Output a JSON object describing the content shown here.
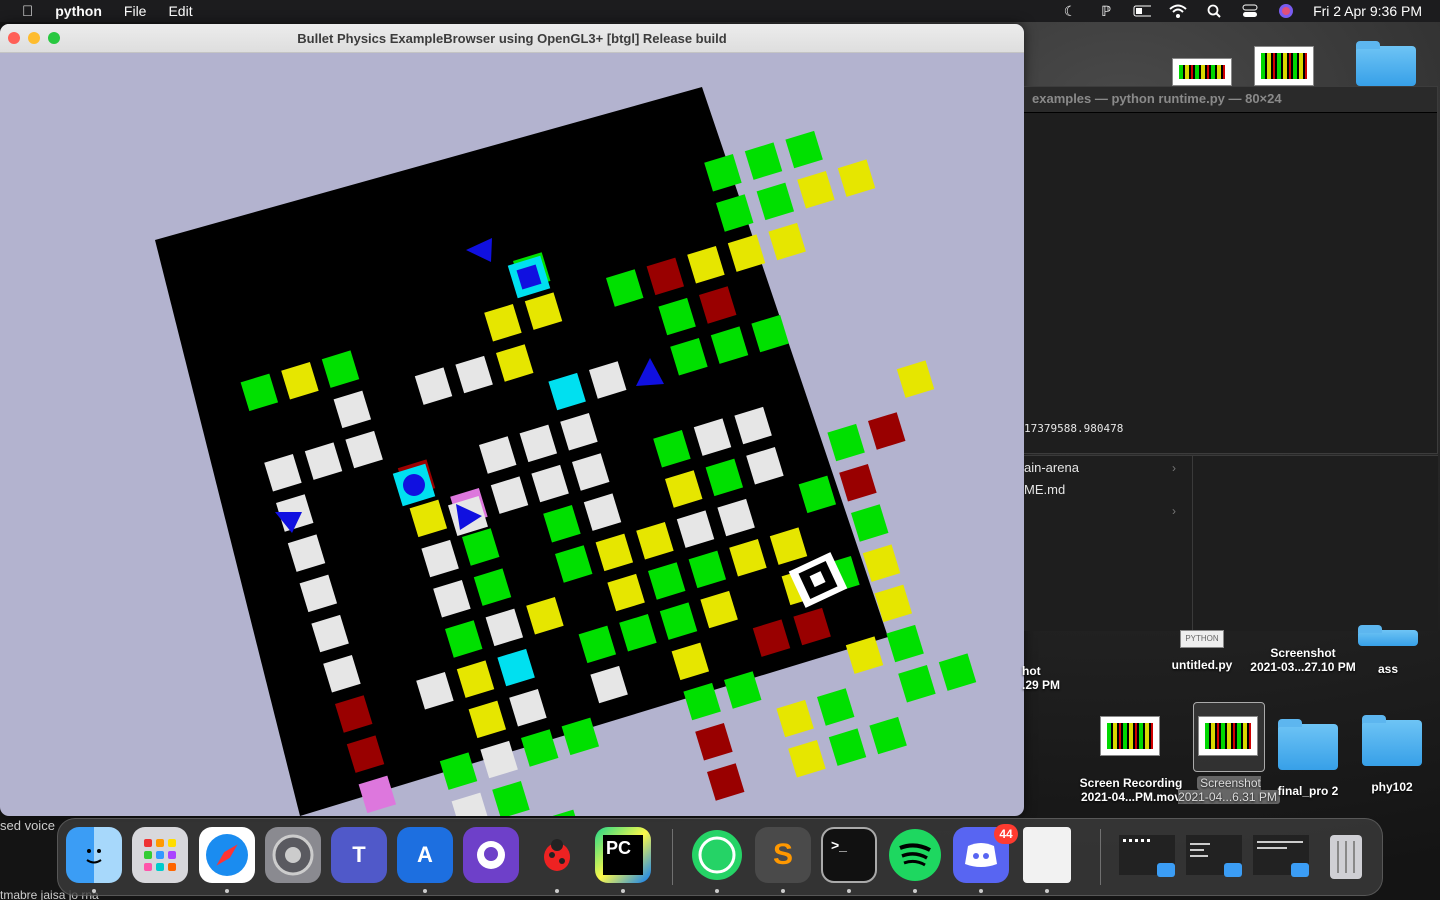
{
  "menubar": {
    "app_name": "python",
    "menus": [
      "File",
      "Edit"
    ],
    "clock": "Fri 2 Apr  9:36 PM"
  },
  "window": {
    "title": "Bullet Physics ExampleBrowser using OpenGL3+ [btgl] Release build",
    "background": "#b3b3cf",
    "board": {
      "rows": 14,
      "cols": 14,
      "rotation_deg": -17,
      "cells_legend": {
        "G": "#00e000",
        "Y": "#e6e600",
        "W": "#e6e6e6",
        "R": "#990000",
        "P": "#dd77dd",
        "C": "#00e0f0",
        "Q": "#e6e6e6",
        "K": "#ffffff"
      },
      "grid": [
        "............GGG.",
        ".......G....GGYY",
        "GYG...YY.GRYYY..",
        "..W.WWY.B.GR.....",
        "WWW....CW.GGG...",
        "W..R.WWW........",
        "W..YPWWW.GWWB..Y",
        "W..WG.GW.YGW.GR.",
        "W..WG.GYYWW.GR..",
        "W..GWY.YGGYY.G..",
        "R.WYC.GGGY.YGY..",
        "R..YQBW.Y.RR.Y..",
        "P.GWGG..GG..YG.K",
        "..WG....R.YG.GG.",
        "..WWG...R.YGG...",
        "..GWWG..........",
        "...W.G.........."
      ]
    },
    "markers": [
      {
        "kind": "triangle",
        "dir": "left"
      },
      {
        "kind": "triangle",
        "dir": "up"
      },
      {
        "kind": "triangle",
        "dir": "down"
      },
      {
        "kind": "triangle",
        "dir": "right"
      },
      {
        "kind": "square"
      },
      {
        "kind": "circle"
      },
      {
        "kind": "aruco"
      }
    ]
  },
  "terminal": {
    "title": "examples — python runtime.py — 80×24",
    "output": "17379588.980478"
  },
  "finder": {
    "rows": [
      "ain-arena",
      "ME.md",
      ""
    ]
  },
  "desktop": {
    "icons": [
      {
        "label": "untitled.py",
        "tag": "PYTHON"
      },
      {
        "label": "Screenshot\n2021-03...27.10 PM"
      },
      {
        "label": "ass"
      },
      {
        "label": "hot\n.29 PM"
      },
      {
        "label": "Screen Recording\n2021-04...PM.mov"
      },
      {
        "label": "Screenshot\n2021-04...6.31 PM"
      },
      {
        "label": "final_pro 2"
      },
      {
        "label": "phy102"
      }
    ]
  },
  "side_text": [
    "sed voice",
    "tmabre jaisa jo rna"
  ],
  "dock": {
    "apps": [
      "Finder",
      "Launchpad",
      "Safari",
      "System Preferences",
      "Microsoft Teams",
      "Xcode",
      "GitHub Desktop",
      "Bug",
      "PyCharm",
      "WhatsApp",
      "Sublime Text",
      "Terminal",
      "Spotify",
      "Discord",
      "TextEdit"
    ],
    "discord_badge": "44"
  }
}
